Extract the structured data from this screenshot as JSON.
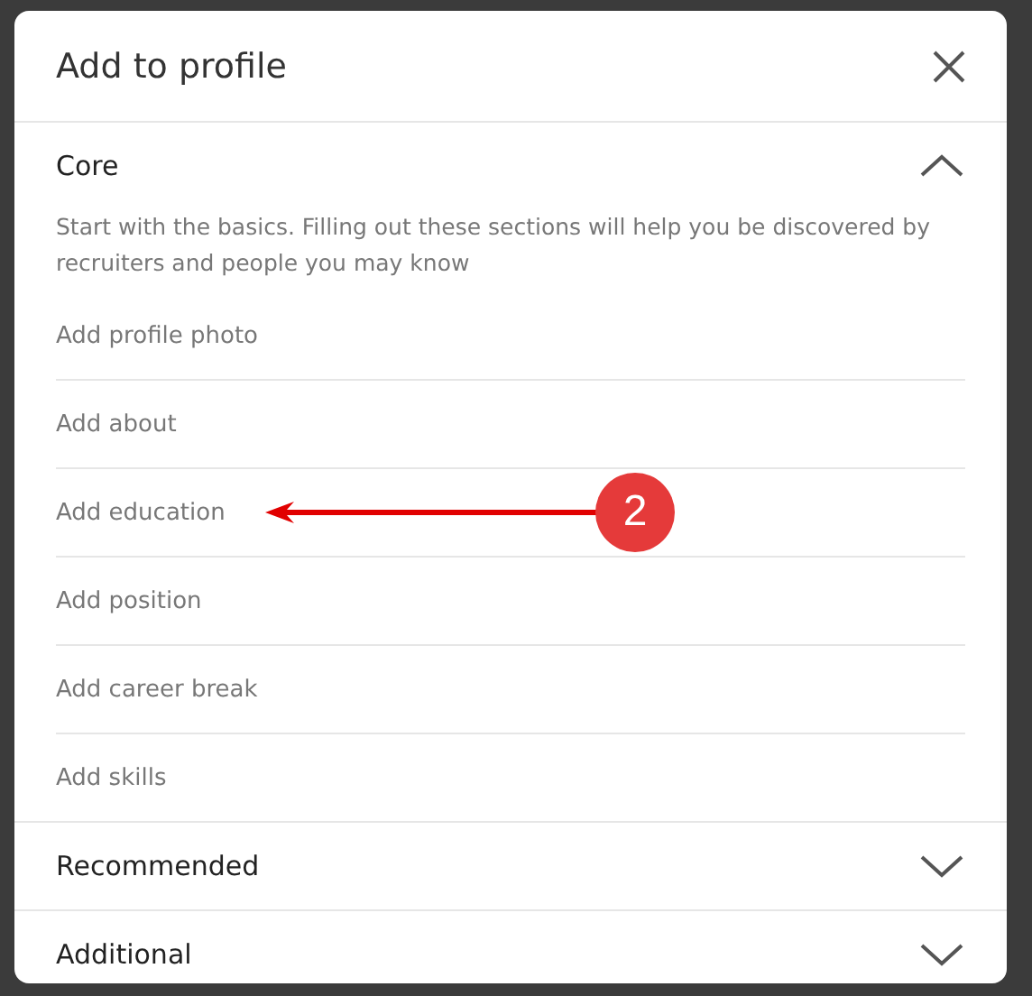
{
  "dialog": {
    "title": "Add to profile"
  },
  "sections": [
    {
      "title": "Core",
      "expanded": true,
      "description": "Start with the basics. Filling out these sections will help you be discovered by recruiters and people you may know",
      "items": [
        {
          "label": "Add profile photo"
        },
        {
          "label": "Add about"
        },
        {
          "label": "Add education",
          "annotation": "2"
        },
        {
          "label": "Add position"
        },
        {
          "label": "Add career break"
        },
        {
          "label": "Add skills"
        }
      ]
    },
    {
      "title": "Recommended",
      "expanded": false
    },
    {
      "title": "Additional",
      "expanded": false
    }
  ]
}
